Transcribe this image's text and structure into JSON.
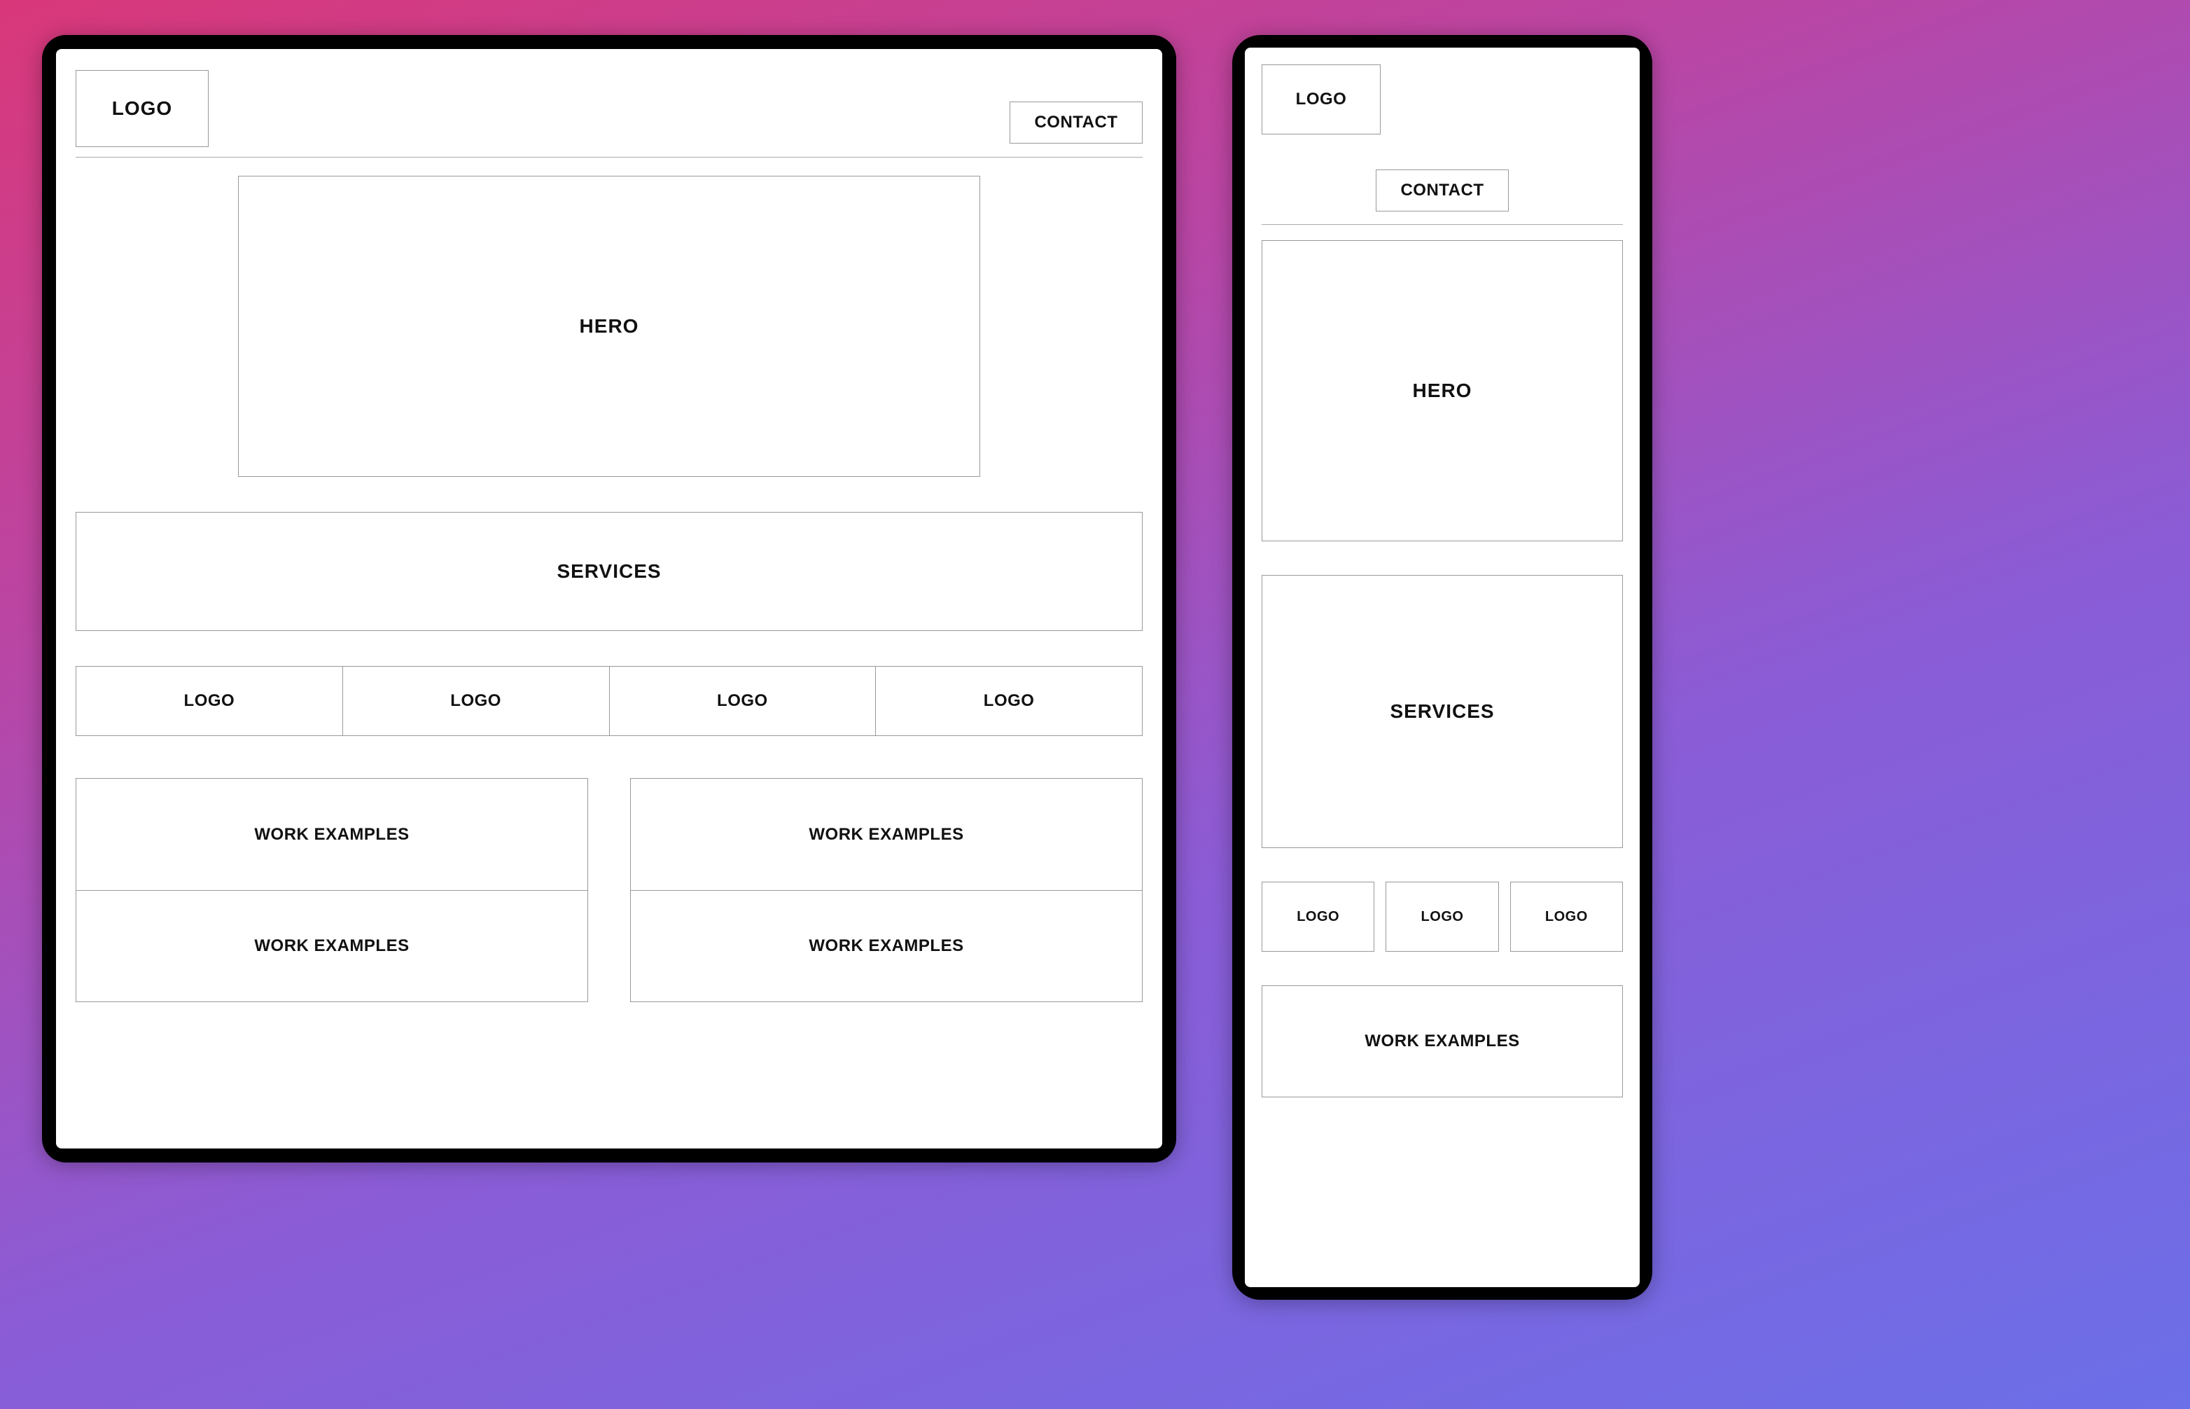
{
  "tablet": {
    "logo": "LOGO",
    "contact": "CONTACT",
    "hero": "HERO",
    "services": "SERVICES",
    "logos": [
      "LOGO",
      "LOGO",
      "LOGO",
      "LOGO"
    ],
    "work_examples": [
      "WORK EXAMPLES",
      "WORK EXAMPLES",
      "WORK EXAMPLES",
      "WORK EXAMPLES"
    ]
  },
  "phone": {
    "logo": "LOGO",
    "contact": "CONTACT",
    "hero": "HERO",
    "services": "SERVICES",
    "logos": [
      "LOGO",
      "LOGO",
      "LOGO"
    ],
    "work_examples": [
      "WORK EXAMPLES"
    ]
  }
}
